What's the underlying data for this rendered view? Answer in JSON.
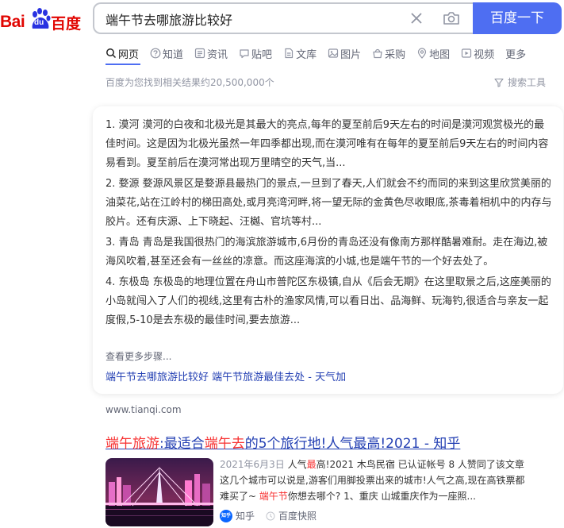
{
  "logo": {
    "latin": "Bai",
    "paw": "du",
    "chinese": "百度"
  },
  "search": {
    "value": "端午节去哪旅游比较好",
    "button_label": "百度一下"
  },
  "tabs": [
    {
      "label": "网页",
      "icon": "search-icon"
    },
    {
      "label": "知道",
      "icon": "question-icon"
    },
    {
      "label": "资讯",
      "icon": "news-icon"
    },
    {
      "label": "贴吧",
      "icon": "tieba-icon"
    },
    {
      "label": "文库",
      "icon": "document-icon"
    },
    {
      "label": "图片",
      "icon": "image-icon"
    },
    {
      "label": "采购",
      "icon": "basket-icon"
    },
    {
      "label": "地图",
      "icon": "map-pin-icon"
    },
    {
      "label": "视频",
      "icon": "play-icon"
    },
    {
      "label": "更多",
      "icon": ""
    }
  ],
  "result_count": "百度为您找到相关结果约20,500,000个",
  "search_tools": "搜索工具",
  "card": {
    "items": [
      "1. 漠河 漠河的白夜和北极光是其最大的亮点,每年的夏至前后9天左右的时间是漠河观赏极光的最佳时间。这是因为北极光虽然一年四季都出现,而在漠河唯有在每年的夏至前后9天左右的时间内容易看到。夏至前后在漠河常出现万里晴空的天气,当...",
      "2. 婺源 婺源风景区是婺源县最热门的景点,一旦到了春天,人们就会不约而同的来到这里欣赏美丽的油菜花,站在江岭村的梯田高处,或月亮湾河畔,将一望无际的金黄色尽收眼底,茶毒着相机中的内存与胶片。还有庆源、上下晓起、汪樾、官坑等村...",
      "3. 青岛 青岛是我国很热门的海滨旅游城市,6月份的青岛还没有像南方那样酷暑难耐。走在海边,被海风吹着,甚至还会有一丝丝的凉意。而这座海滨的小城,也是端午节的一个好去处了。",
      "4. 东极岛 东极岛的地理位置在舟山市普陀区东极镇,自从《后会无期》在这里取景之后,这座美丽的小岛就闯入了人们的视线,这里有古朴的渔家风情,可以看日出、品海鲜、玩海钓,很适合与亲友一起度假,5-10是去东极的最佳时间,要去旅游..."
    ],
    "more_steps": "查看更多步骤...",
    "link": "端午节去哪旅游比较好 端午节旅游最佳去处 - 天气加"
  },
  "source_url": "www.tianqi.com",
  "result": {
    "title_parts": [
      {
        "text": "端午旅游",
        "em": true
      },
      {
        "text": ":最适合",
        "em": false
      },
      {
        "text": "端午去",
        "em": true
      },
      {
        "text": "的5个旅行地!人气最高!2021 - 知乎",
        "em": false
      }
    ],
    "date": "2021年6月3日",
    "snippet_lines": [
      {
        "parts": [
          {
            "text": " 人气",
            "em": false
          },
          {
            "text": "最",
            "em": true
          },
          {
            "text": "高!2021 木鸟民宿 已认证帐号 8 人赞同了该文章",
            "em": false
          }
        ]
      },
      {
        "parts": [
          {
            "text": "这几个城市可以说是,游客们用脚投票出来的城市!人气之高,现在高铁票都",
            "em": false
          }
        ]
      },
      {
        "parts": [
          {
            "text": "难买了~ ",
            "em": false
          },
          {
            "text": "端午节",
            "em": true
          },
          {
            "text": "你想去哪个? 1、重庆 山城重庆作为一座照...",
            "em": false
          }
        ]
      }
    ],
    "source_name": "知乎",
    "source_badge": "知乎",
    "snapshot": "百度快照"
  },
  "colors": {
    "brand_red": "#e10602",
    "brand_blue": "#4e6ef2",
    "link_blue": "#2440b3",
    "highlight_red": "#f73131"
  }
}
